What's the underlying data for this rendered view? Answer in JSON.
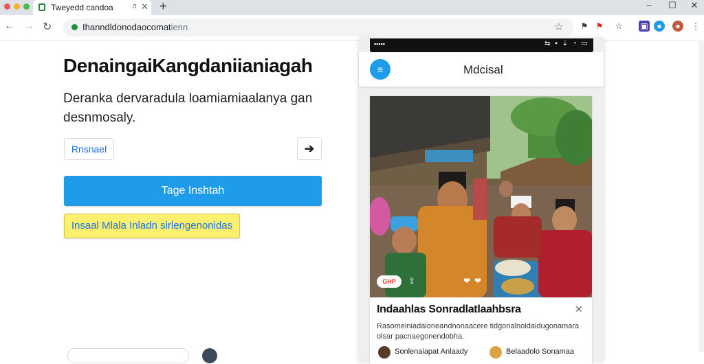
{
  "browser": {
    "tab_title": "Tweyedd candoa",
    "tab_mute_icon": "speaker-icon",
    "new_tab_label": "+",
    "window_controls": {
      "minimize": "–",
      "maximize": "☐",
      "close": "✕"
    },
    "nav": {
      "back": "←",
      "forward": "→",
      "reload": "↻"
    },
    "url_main": "Ihanndldonodaocomat",
    "url_rest": "ienn",
    "bookmark_star": "☆",
    "extensions": [
      "flag-icon",
      "bookmark-icon",
      "puzzle-icon",
      "settings-icon",
      "profile-icon"
    ],
    "colors": {
      "secure": "#1e8e3e",
      "tab_strip": "#dee1e6"
    }
  },
  "page": {
    "headline": "DenaingaiKangdaniianiagah",
    "description": "Deranka dervaradula loamiamiaalanya gan desnmosaly.",
    "outline_button": "Rnsnael",
    "arrow_button": "➔",
    "primary_button": "Tage Inshtah",
    "yellow_button": "Insaal Mlala Inladn sirlengenonidas",
    "colors": {
      "primary": "#1e9be9",
      "yellow": "#fdf06e",
      "link": "#1a73e8"
    }
  },
  "phone": {
    "status_left": "▪▪▪▪▪",
    "status_icons": "⇆ ▪ ⇣ ◔ ▭",
    "menu_icon": "≡",
    "app_title": "Mdcisal",
    "card": {
      "badge": "GHP",
      "photo_icons": [
        "share-icon",
        "heart-icon"
      ],
      "title": "Indaahlas Sonradlatlaahbsra",
      "close": "✕",
      "description": "Rasomeiniadaioneandnonaacere tidgonalnoidaidugonamara olsar pacnaegonendobha.",
      "authors": [
        "Sonlenaiapat Anlaady",
        "Belaadolo Sonamaa"
      ]
    }
  }
}
